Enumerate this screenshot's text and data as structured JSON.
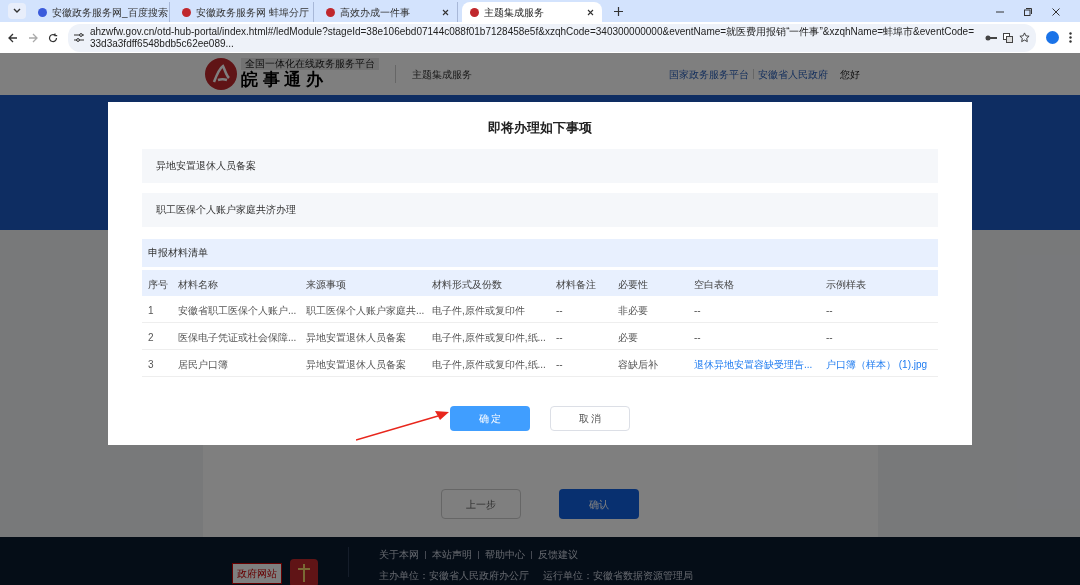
{
  "browser": {
    "tabs": [
      {
        "title": "安徽政务服务网_百度搜索",
        "selected": false
      },
      {
        "title": "安徽政务服务网 蚌埠分厅",
        "selected": false
      },
      {
        "title": "高效办成一件事",
        "selected": false
      },
      {
        "title": "主题集成服务",
        "selected": true
      }
    ],
    "url": "ahzwfw.gov.cn/otd-hub-portal/index.html#/ledModule?stageId=38e106ebd07144c088f01b7128458e5f&xzqhCode=340300000000&eventName=就医费用报销“一件事”&xzqhName=蚌埠市&eventCode=33d3a3fdff6548bdb5c62ee089..."
  },
  "header": {
    "platform": "全国一体化在线政务服务平台",
    "brand": "皖 事 通 办",
    "section": "主题集成服务",
    "links": [
      "国家政务服务平台",
      "安徽省人民政府"
    ],
    "greeting": "您好"
  },
  "page": {
    "buttons": [
      {
        "label": "上一步",
        "kind": "secondary"
      },
      {
        "label": "确认",
        "kind": "primary"
      }
    ]
  },
  "footer": {
    "links": [
      "关于本网",
      "本站声明",
      "帮助中心",
      "反馈建议"
    ],
    "sponsor": "主办单位：安徽省人民政府办公厅",
    "operator": "运行单位：安徽省数据资源管理局",
    "badge": "政府网站"
  },
  "dialog": {
    "title": "即将办理如下事项",
    "items": [
      "异地安置退休人员备案",
      "职工医保个人账户家庭共济办理"
    ],
    "materials": {
      "title": "申报材料清单",
      "columns": [
        "序号",
        "材料名称",
        "来源事项",
        "材料形式及份数",
        "材料备注",
        "必要性",
        "空白表格",
        "示例样表"
      ],
      "rows": [
        {
          "cells": [
            "1",
            "安徽省职工医保个人账户...",
            "职工医保个人账户家庭共...",
            "电子件,原件或复印件",
            "--",
            "非必要",
            "--",
            "--"
          ],
          "links": [
            false,
            false,
            false,
            false,
            false,
            false,
            false,
            false
          ]
        },
        {
          "cells": [
            "2",
            "医保电子凭证或社会保障...",
            "异地安置退休人员备案",
            "电子件,原件或复印件,纸...",
            "--",
            "必要",
            "--",
            "--"
          ],
          "links": [
            false,
            false,
            false,
            false,
            false,
            false,
            false,
            false
          ]
        },
        {
          "cells": [
            "3",
            "居民户口簿",
            "异地安置退休人员备案",
            "电子件,原件或复印件,纸...",
            "--",
            "容缺后补",
            "退休异地安置容缺受理告...",
            "户口簿（样本） (1).jpg"
          ],
          "links": [
            false,
            false,
            false,
            false,
            false,
            false,
            true,
            true
          ]
        }
      ]
    },
    "buttons": [
      {
        "label": "确 定",
        "kind": "primary"
      },
      {
        "label": "取 消",
        "kind": "secondary"
      }
    ]
  }
}
